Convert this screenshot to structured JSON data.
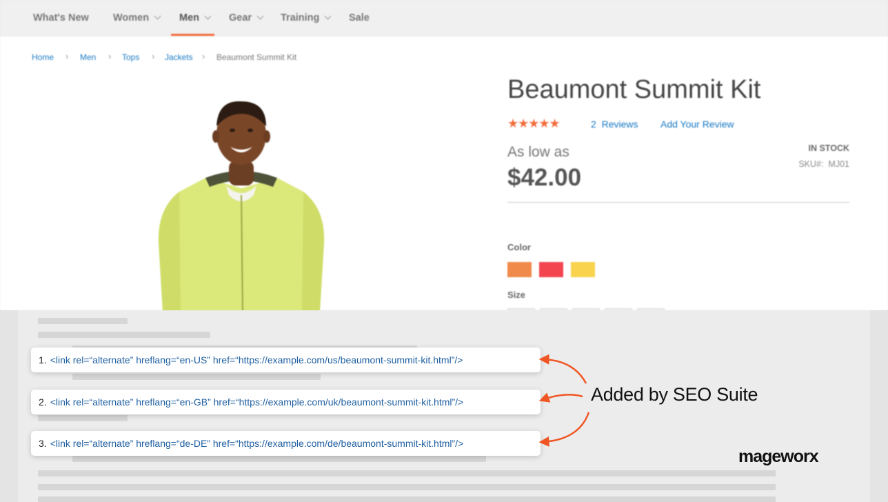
{
  "nav": {
    "items": [
      {
        "label": "What's New",
        "dropdown": false
      },
      {
        "label": "Women",
        "dropdown": true
      },
      {
        "label": "Men",
        "dropdown": true,
        "active": true
      },
      {
        "label": "Gear",
        "dropdown": true
      },
      {
        "label": "Training",
        "dropdown": true
      },
      {
        "label": "Sale",
        "dropdown": false
      }
    ]
  },
  "breadcrumb": [
    "Home",
    "Men",
    "Tops",
    "Jackets",
    "Beaumont Summit Kit"
  ],
  "product": {
    "title": "Beaumont Summit Kit",
    "stars": "★★★★★",
    "rating_fraction": 0.9,
    "reviews_count": "2",
    "reviews_label": "Reviews",
    "add_review_label": "Add Your Review",
    "as_low_as": "As low as",
    "price": "$42.00",
    "stock": "IN STOCK",
    "sku_label": "SKU#:",
    "sku": "MJ01",
    "color_label": "Color",
    "swatches": [
      "#ef8a4b",
      "#f24550",
      "#f9d34d"
    ],
    "size_label": "Size"
  },
  "code_lines": [
    {
      "num": "1.",
      "code": "<link rel=“alternate” hreflang=“en-US” href=“https://example.com/us/beaumont-summit-kit.html”/>"
    },
    {
      "num": "2.",
      "code": "<link rel=“alternate” hreflang=“en-GB” href=“https://example.com/uk/beaumont-summit-kit.html”/>"
    },
    {
      "num": "3.",
      "code": "<link rel=“alternate” hreflang=“de-DE” href=“https://example.com/de/beaumont-summit-kit.html”/>"
    }
  ],
  "callout": "Added by SEO Suite",
  "brand": "mageworx",
  "colors": {
    "accent": "#f05523",
    "link": "#1979c3",
    "code_text": "#1f5fa0"
  }
}
